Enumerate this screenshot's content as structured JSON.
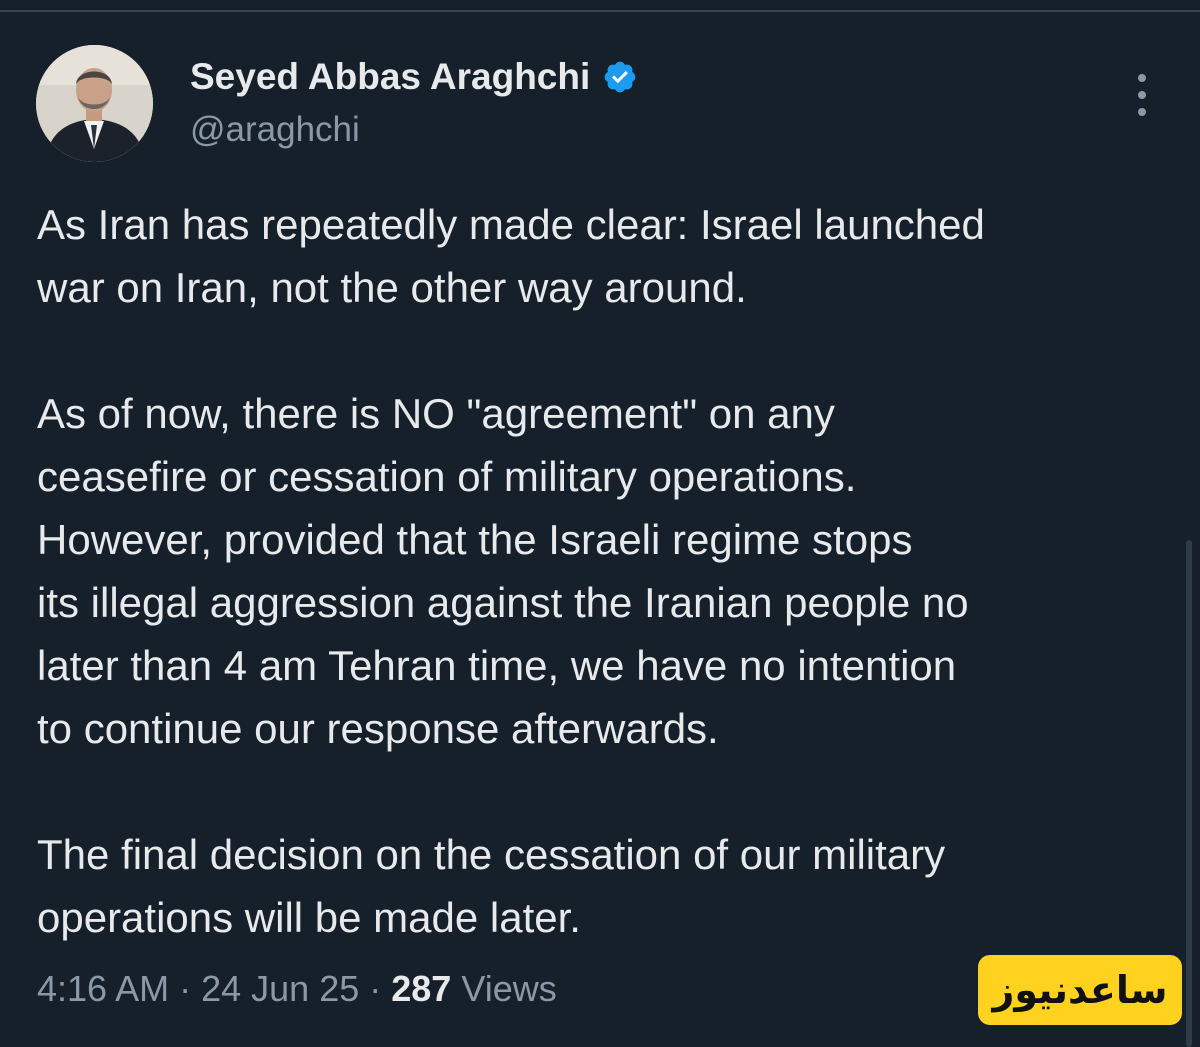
{
  "author": {
    "name": "Seyed Abbas Araghchi",
    "handle": "@araghchi",
    "verified": true
  },
  "tweet": {
    "paragraphs": [
      "As Iran has repeatedly made clear: Israel launched\nwar on Iran, not the other way around.",
      "As of now, there is NO \"agreement\" on any\nceasefire or cessation of military operations.\nHowever, provided that the Israeli regime stops\nits illegal aggression against the Iranian people no\nlater than 4 am Tehran time, we have no intention\nto continue our response afterwards.",
      "The final decision on the cessation of our military\noperations will be made later."
    ],
    "time": "4:16 AM",
    "date": "24 Jun 25",
    "views_count": "287",
    "views_label": "Views"
  },
  "watermark": {
    "text": "ساعدنیوز"
  },
  "icons": {
    "verified": "verified-badge-icon",
    "more": "more-options-icon"
  },
  "colors": {
    "background": "#15202b",
    "text": "#e7e9ea",
    "secondary": "#8b98a5",
    "verified": "#1d9bf0",
    "watermark_bg": "#ffd21f"
  }
}
